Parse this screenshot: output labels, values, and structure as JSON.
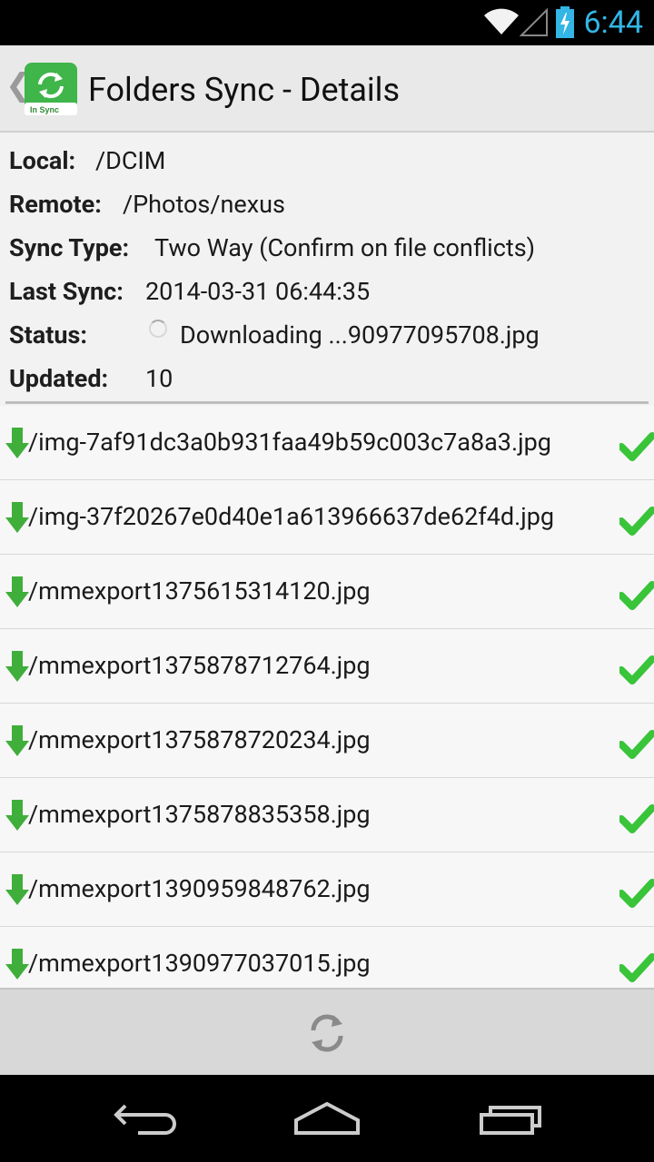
{
  "status_bar": {
    "time": "6:44",
    "icons": [
      "wifi-icon",
      "signal-icon",
      "battery-charging-icon"
    ]
  },
  "action_bar": {
    "title": "Folders Sync - Details",
    "app_icon_label": "In Sync",
    "back_glyph": "❮"
  },
  "details": {
    "local": {
      "label": "Local:",
      "value": "/DCIM"
    },
    "remote": {
      "label": "Remote:",
      "value": "/Photos/nexus"
    },
    "sync_type": {
      "label": "Sync Type:",
      "value": "Two Way (Confirm on file conflicts)"
    },
    "last_sync": {
      "label": "Last Sync:",
      "value": "2014-03-31 06:44:35"
    },
    "status": {
      "label": "Status:",
      "value": "Downloading ...90977095708.jpg"
    },
    "updated": {
      "label": "Updated:",
      "value": "10"
    }
  },
  "files": [
    {
      "name": "/img-7af91dc3a0b931faa49b59c003c7a8a3.jpg",
      "direction": "download",
      "state": "done"
    },
    {
      "name": "/img-37f20267e0d40e1a613966637de62f4d.jpg",
      "direction": "download",
      "state": "done"
    },
    {
      "name": "/mmexport1375615314120.jpg",
      "direction": "download",
      "state": "done"
    },
    {
      "name": "/mmexport1375878712764.jpg",
      "direction": "download",
      "state": "done"
    },
    {
      "name": "/mmexport1375878720234.jpg",
      "direction": "download",
      "state": "done"
    },
    {
      "name": "/mmexport1375878835358.jpg",
      "direction": "download",
      "state": "done"
    },
    {
      "name": "/mmexport1390959848762.jpg",
      "direction": "download",
      "state": "done"
    },
    {
      "name": "/mmexport1390977037015.jpg",
      "direction": "download",
      "state": "done"
    }
  ],
  "colors": {
    "accent": "#33b5e5",
    "app_green": "#3fb54a",
    "check_green": "#39c43a",
    "arrow_green": "#3fae3a"
  }
}
